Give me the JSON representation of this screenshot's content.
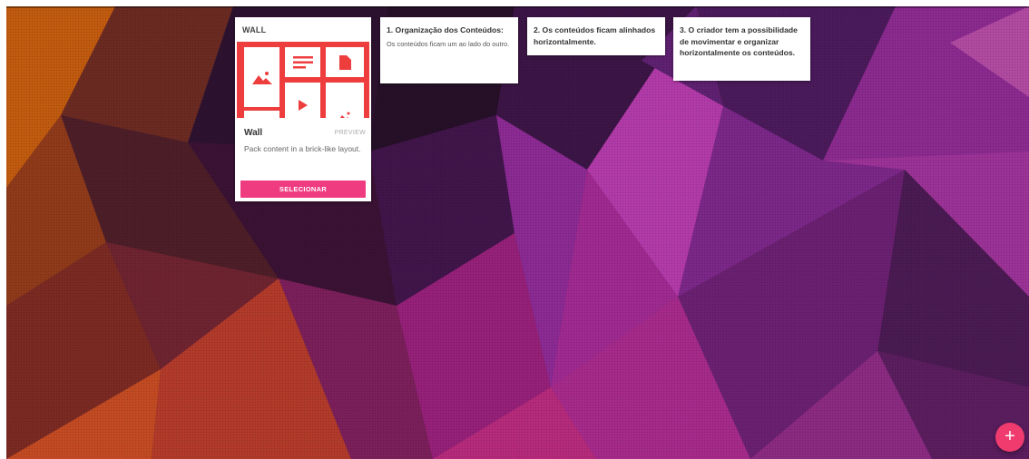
{
  "wall_card": {
    "header": "WALL",
    "item_name": "Wall",
    "preview_label": "PREVIEW",
    "description": "Pack content in a brick-like layout.",
    "select_label": "SELECIONAR",
    "preview_tiles": [
      "image-icon",
      "text-lines-icon",
      "document-icon",
      "image-icon",
      "play-icon",
      "image-icon"
    ]
  },
  "notes": [
    {
      "title": "1. Organização dos Conteúdos:",
      "body": "Os conteúdos ficam um ao lado do outro."
    },
    {
      "title": "2. Os conteúdos ficam alinhados horizontalmente.",
      "body": ""
    },
    {
      "title": "3. O criador tem a possibilidade de movimentar e organizar horizontalmente os conteúdos.",
      "body": ""
    }
  ],
  "fab": {
    "label": "+"
  },
  "colors": {
    "accent": "#ef3b80",
    "preview_red": "#ee3d3d",
    "bg_purple": "#7a1f6e",
    "bg_orange": "#c85a10"
  }
}
